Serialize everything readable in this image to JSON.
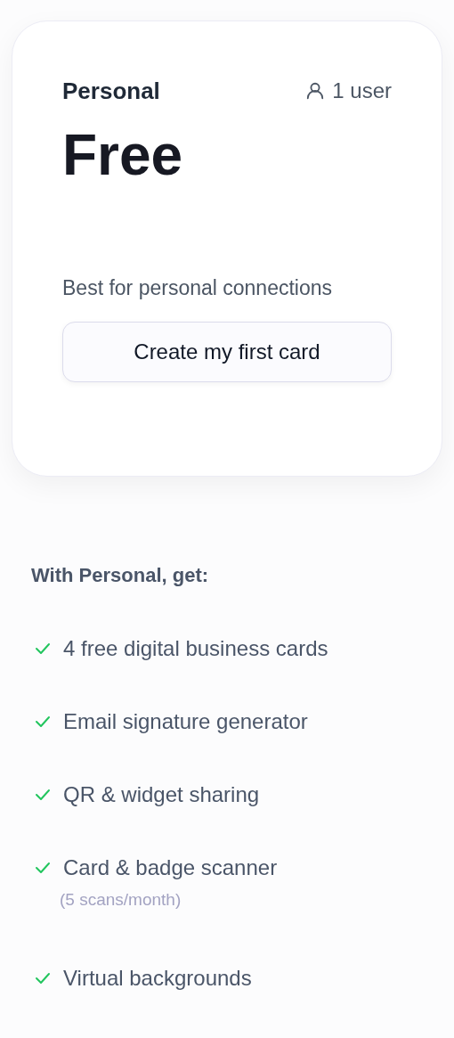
{
  "plan": {
    "name": "Personal",
    "users": "1 user",
    "price": "Free",
    "description": "Best for personal connections",
    "button": "Create my first card"
  },
  "features": {
    "heading": "With Personal, get:",
    "items": [
      {
        "text": "4 free digital business cards"
      },
      {
        "text": "Email signature generator"
      },
      {
        "text": "QR & widget sharing"
      },
      {
        "text": "Card & badge scanner",
        "note": "(5 scans/month)"
      },
      {
        "text": "Virtual backgrounds"
      }
    ]
  }
}
